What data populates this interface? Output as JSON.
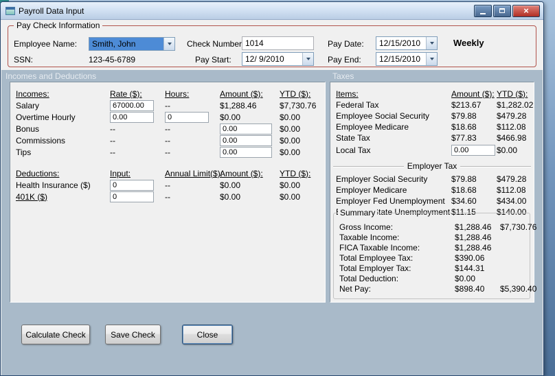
{
  "window": {
    "title": "Payroll Data Input",
    "close_glyph": "×"
  },
  "paycheck": {
    "group_label": "Pay Check Information",
    "fields": {
      "employee_name": {
        "label": "Employee Name:",
        "value": "Smith, John"
      },
      "ssn": {
        "label": "SSN:",
        "value": "123-45-6789"
      },
      "check_number": {
        "label": "Check Number:",
        "value": "1014"
      },
      "pay_start": {
        "label": "Pay Start:",
        "value": "12/ 9/2010"
      },
      "pay_date": {
        "label": "Pay Date:",
        "value": "12/15/2010"
      },
      "pay_end": {
        "label": "Pay End:",
        "value": "12/15/2010"
      }
    },
    "frequency": "Weekly"
  },
  "section_headers": {
    "left": "Incomes and Deductions",
    "right": "Taxes"
  },
  "incomes": {
    "headers": {
      "c0": "Incomes:",
      "c1": "Rate ($):",
      "c2": "Hours:",
      "c3": "Amount ($):",
      "c4": "YTD ($):"
    },
    "salary": {
      "label": "Salary",
      "rate": "67000.00",
      "hours": "--",
      "amount": "$1,288.46",
      "ytd": "$7,730.76"
    },
    "overtime": {
      "label": "Overtime Hourly",
      "rate": "0.00",
      "hours": "0",
      "amount": "$0.00",
      "ytd": "$0.00"
    },
    "bonus": {
      "label": "Bonus",
      "rate": "--",
      "hours": "--",
      "amount": "0.00",
      "ytd": "$0.00"
    },
    "commissions": {
      "label": "Commissions",
      "rate": "--",
      "hours": "--",
      "amount": "0.00",
      "ytd": "$0.00"
    },
    "tips": {
      "label": "Tips",
      "rate": "--",
      "hours": "--",
      "amount": "0.00",
      "ytd": "$0.00"
    }
  },
  "deductions": {
    "headers": {
      "c0": "Deductions:",
      "c1": "Input:",
      "c2": "Annual Limit($):",
      "c3": "Amount ($):",
      "c4": "YTD ($):"
    },
    "health": {
      "label": "Health Insurance  ($)",
      "input": "0",
      "limit": "--",
      "amount": "$0.00",
      "ytd": "$0.00"
    },
    "k401": {
      "label": "401K  ($)",
      "input": "0",
      "limit": "--",
      "amount": "$0.00",
      "ytd": "$0.00"
    }
  },
  "taxes": {
    "headers": {
      "c0": "Items:",
      "c1": "Amount ($):",
      "c2": "YTD ($):"
    },
    "rows_employee": [
      {
        "label": "Federal Tax",
        "amount": "$213.67",
        "ytd": "$1,282.02"
      },
      {
        "label": "Employee Social Security",
        "amount": "$79.88",
        "ytd": "$479.28"
      },
      {
        "label": "Employee Medicare",
        "amount": "$18.68",
        "ytd": "$112.08"
      },
      {
        "label": "State Tax",
        "amount": "$77.83",
        "ytd": "$466.98"
      }
    ],
    "local_tax": {
      "label": "Local Tax",
      "amount": "0.00",
      "ytd": "$0.00"
    },
    "employer_header": "Employer Tax",
    "rows_employer": [
      {
        "label": "Employer Social Security",
        "amount": "$79.88",
        "ytd": "$479.28"
      },
      {
        "label": "Employer Medicare",
        "amount": "$18.68",
        "ytd": "$112.08"
      },
      {
        "label": "Employer Fed Unemployment",
        "amount": "$34.60",
        "ytd": "$434.00"
      },
      {
        "label": "Employer State Unemployment",
        "amount": "$11.15",
        "ytd": "$140.00"
      }
    ]
  },
  "summary": {
    "group_label": "Summary",
    "rows": [
      {
        "label": "Gross Income:",
        "amount": "$1,288.46",
        "ytd": "$7,730.76"
      },
      {
        "label": "Taxable Income:",
        "amount": "$1,288.46",
        "ytd": ""
      },
      {
        "label": "FICA Taxable Income:",
        "amount": "$1,288.46",
        "ytd": ""
      },
      {
        "label": "Total Employee Tax:",
        "amount": "$390.06",
        "ytd": ""
      },
      {
        "label": "Total Employer Tax:",
        "amount": "$144.31",
        "ytd": ""
      },
      {
        "label": "Total Deduction:",
        "amount": "$0.00",
        "ytd": ""
      },
      {
        "label": "Net Pay:",
        "amount": "$898.40",
        "ytd": "$5,390.40"
      }
    ]
  },
  "buttons": {
    "calculate": "Calculate Check",
    "save": "Save Check",
    "close": "Close"
  }
}
